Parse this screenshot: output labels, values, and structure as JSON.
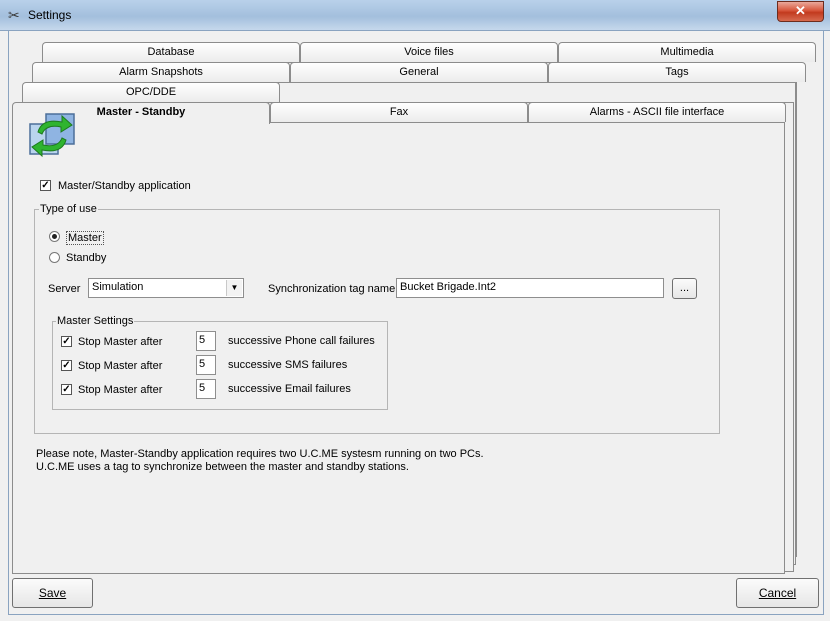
{
  "window": {
    "title": "Settings",
    "close_label": "✕"
  },
  "tabs": {
    "row1": [
      "Database",
      "Voice files",
      "Multimedia"
    ],
    "row2": [
      "Alarm Snapshots",
      "General",
      "Tags"
    ],
    "row3": [
      "OPC/DDE"
    ],
    "row4": [
      "Master - Standby",
      "Fax",
      "Alarms - ASCII file interface"
    ]
  },
  "master_standby": {
    "app_checkbox_label": "Master/Standby application",
    "type_of_use": {
      "title": "Type of use",
      "master_label": "Master",
      "standby_label": "Standby",
      "selected": "Master"
    },
    "server_label": "Server",
    "server_value": "Simulation",
    "sync_label": "Synchronization tag name",
    "sync_value": "Bucket Brigade.Int2",
    "browse_label": "...",
    "master_settings": {
      "title": "Master Settings",
      "rows": [
        {
          "check_label": "Stop Master after",
          "value": "5",
          "suffix": "successive Phone call failures"
        },
        {
          "check_label": "Stop Master after",
          "value": "5",
          "suffix": "successive SMS failures"
        },
        {
          "check_label": "Stop Master after",
          "value": "5",
          "suffix": "successive Email failures"
        }
      ]
    },
    "note_line1": "Please note, Master-Standby application requires two U.C.ME systesm running on two PCs.",
    "note_line2": "U.C.ME uses a tag to synchronize between the master and standby stations."
  },
  "footer": {
    "save_label": "Save",
    "cancel_label": "Cancel"
  }
}
